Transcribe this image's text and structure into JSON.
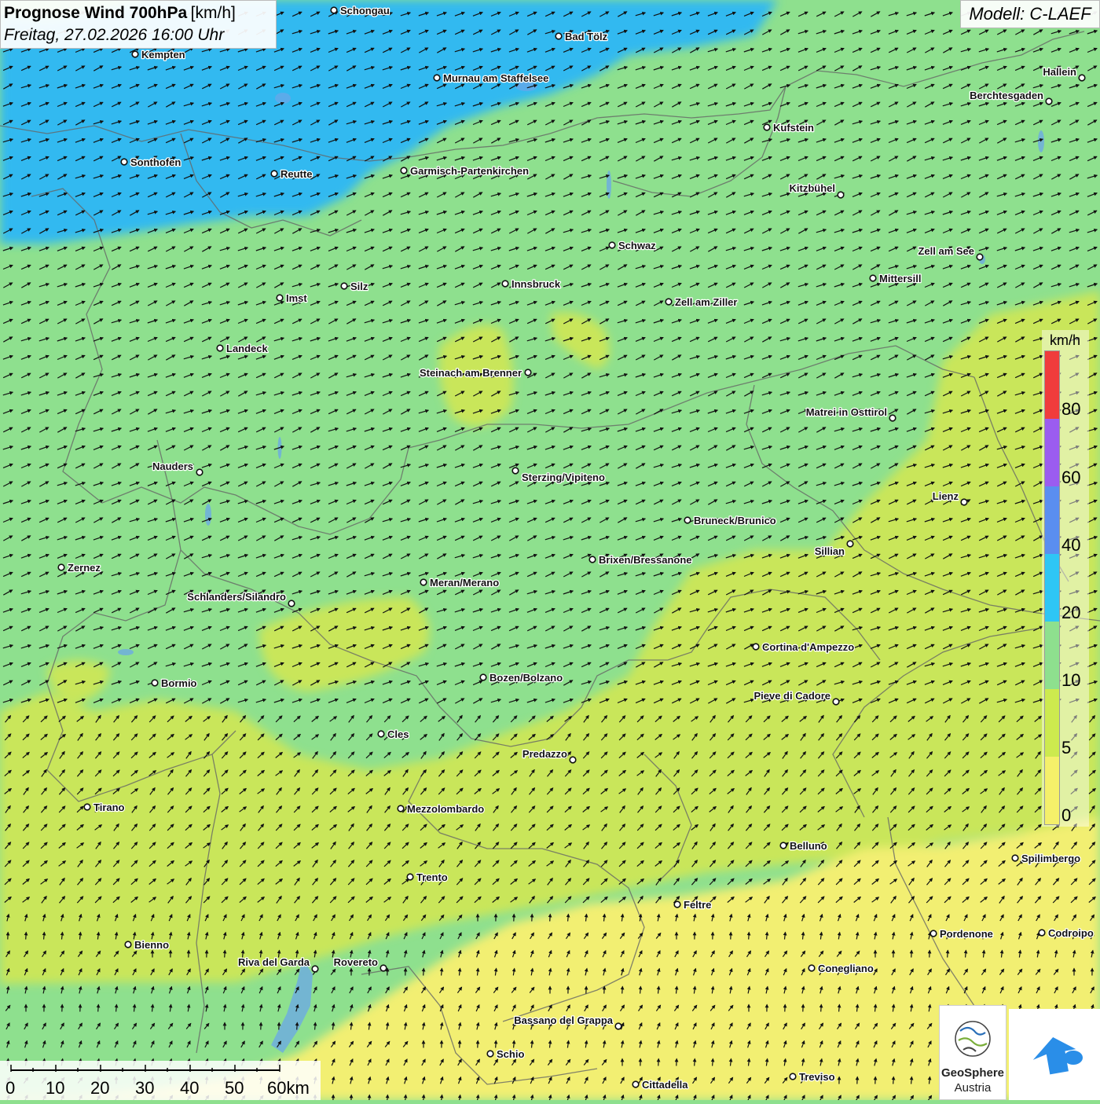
{
  "title": {
    "main": "Prognose Wind 700hPa",
    "unit": "[km/h]",
    "date": "Freitag, 27.02.2026 16:00 Uhr"
  },
  "model": "Modell: C-LAEF",
  "legend": {
    "unit": "km/h",
    "labels": [
      "80",
      "60",
      "40",
      "20",
      "10",
      "5",
      "0"
    ],
    "colors": [
      "#f03c3c",
      "#9b5cf0",
      "#5a8ef0",
      "#2ec6f5",
      "#8ee08e",
      "#cdea4e",
      "#f5f06a"
    ]
  },
  "scale": {
    "labels": [
      "0",
      "10",
      "20",
      "30",
      "40",
      "50",
      "60km"
    ]
  },
  "logo": {
    "name_line1": "GeoSphere",
    "name_line2": "Austria",
    "icon": "geosphere-logo-icon",
    "app_icon": "app-arrow-icon"
  },
  "wind_colors": {
    "fast": "#33b9f0",
    "medium": "#8ee08e",
    "light": "#c9e65a",
    "calm": "#f2ef72"
  },
  "cities": [
    {
      "name": "Schongau",
      "dot": [
        425,
        13
      ],
      "lab": [
        433,
        18
      ],
      "a": "start"
    },
    {
      "name": "Bad Tölz",
      "dot": [
        711,
        46
      ],
      "lab": [
        719,
        51
      ],
      "a": "start"
    },
    {
      "name": "Kempten",
      "dot": [
        172,
        69
      ],
      "lab": [
        180,
        74
      ],
      "a": "start"
    },
    {
      "name": "Murnau am Staffelsee",
      "dot": [
        556,
        99
      ],
      "lab": [
        564,
        104
      ],
      "a": "start"
    },
    {
      "name": "Hallein",
      "dot": [
        1377,
        99
      ],
      "lab": [
        1370,
        96
      ],
      "a": "end"
    },
    {
      "name": "Berchtesgaden",
      "dot": [
        1335,
        129
      ],
      "lab": [
        1328,
        126
      ],
      "a": "end"
    },
    {
      "name": "Kufstein",
      "dot": [
        976,
        162
      ],
      "lab": [
        984,
        167
      ],
      "a": "start"
    },
    {
      "name": "Sonthofen",
      "dot": [
        158,
        206
      ],
      "lab": [
        166,
        211
      ],
      "a": "start"
    },
    {
      "name": "Reutte",
      "dot": [
        349,
        221
      ],
      "lab": [
        357,
        226
      ],
      "a": "start"
    },
    {
      "name": "Garmisch-Partenkirchen",
      "dot": [
        514,
        217
      ],
      "lab": [
        522,
        222
      ],
      "a": "start"
    },
    {
      "name": "Kitzbühel",
      "dot": [
        1070,
        248
      ],
      "lab": [
        1063,
        244
      ],
      "a": "end"
    },
    {
      "name": "Schwaz",
      "dot": [
        779,
        312
      ],
      "lab": [
        787,
        317
      ],
      "a": "start"
    },
    {
      "name": "Zell am See",
      "dot": [
        1247,
        327
      ],
      "lab": [
        1240,
        324
      ],
      "a": "end"
    },
    {
      "name": "Mittersill",
      "dot": [
        1111,
        354
      ],
      "lab": [
        1119,
        359
      ],
      "a": "start"
    },
    {
      "name": "Silz",
      "dot": [
        438,
        364
      ],
      "lab": [
        446,
        369
      ],
      "a": "start"
    },
    {
      "name": "Innsbruck",
      "dot": [
        643,
        361
      ],
      "lab": [
        651,
        366
      ],
      "a": "start"
    },
    {
      "name": "Imst",
      "dot": [
        356,
        379
      ],
      "lab": [
        364,
        384
      ],
      "a": "start"
    },
    {
      "name": "Zell am Ziller",
      "dot": [
        851,
        384
      ],
      "lab": [
        859,
        389
      ],
      "a": "start"
    },
    {
      "name": "Landeck",
      "dot": [
        280,
        443
      ],
      "lab": [
        288,
        448
      ],
      "a": "start"
    },
    {
      "name": "Steinach am Brenner",
      "dot": [
        672,
        474
      ],
      "lab": [
        664,
        479
      ],
      "a": "end"
    },
    {
      "name": "Matrei in Osttirol",
      "dot": [
        1136,
        532
      ],
      "lab": [
        1129,
        529
      ],
      "a": "end"
    },
    {
      "name": "Nauders",
      "dot": [
        254,
        601
      ],
      "lab": [
        246,
        598
      ],
      "a": "end"
    },
    {
      "name": "Sterzing/Vipiteno",
      "dot": [
        656,
        599
      ],
      "lab": [
        664,
        612
      ],
      "a": "start"
    },
    {
      "name": "Lienz",
      "dot": [
        1227,
        639
      ],
      "lab": [
        1220,
        636
      ],
      "a": "end"
    },
    {
      "name": "Bruneck/Brunico",
      "dot": [
        875,
        662
      ],
      "lab": [
        883,
        667
      ],
      "a": "start"
    },
    {
      "name": "Sillian",
      "dot": [
        1082,
        692
      ],
      "lab": [
        1075,
        706
      ],
      "a": "end"
    },
    {
      "name": "Brixen/Bressanone",
      "dot": [
        754,
        712
      ],
      "lab": [
        762,
        717
      ],
      "a": "start"
    },
    {
      "name": "Zernez",
      "dot": [
        78,
        722
      ],
      "lab": [
        86,
        727
      ],
      "a": "start"
    },
    {
      "name": "Meran/Merano",
      "dot": [
        539,
        741
      ],
      "lab": [
        547,
        746
      ],
      "a": "start"
    },
    {
      "name": "Schlanders/Silandro",
      "dot": [
        371,
        768
      ],
      "lab": [
        364,
        764
      ],
      "a": "end"
    },
    {
      "name": "Cortina d'Ampezzo",
      "dot": [
        962,
        823
      ],
      "lab": [
        970,
        828
      ],
      "a": "start"
    },
    {
      "name": "Bozen/Bolzano",
      "dot": [
        615,
        862
      ],
      "lab": [
        623,
        867
      ],
      "a": "start"
    },
    {
      "name": "Bormio",
      "dot": [
        197,
        869
      ],
      "lab": [
        205,
        874
      ],
      "a": "start"
    },
    {
      "name": "Pieve di Cadore",
      "dot": [
        1064,
        893
      ],
      "lab": [
        1057,
        890
      ],
      "a": "end"
    },
    {
      "name": "Cles",
      "dot": [
        485,
        934
      ],
      "lab": [
        493,
        939
      ],
      "a": "start"
    },
    {
      "name": "Predazzo",
      "dot": [
        729,
        967
      ],
      "lab": [
        722,
        964
      ],
      "a": "end"
    },
    {
      "name": "Tirano",
      "dot": [
        111,
        1027
      ],
      "lab": [
        119,
        1032
      ],
      "a": "start"
    },
    {
      "name": "Mezzolombardo",
      "dot": [
        510,
        1029
      ],
      "lab": [
        518,
        1034
      ],
      "a": "start"
    },
    {
      "name": "Belluno",
      "dot": [
        997,
        1076
      ],
      "lab": [
        1005,
        1081
      ],
      "a": "start"
    },
    {
      "name": "Spilimbergo",
      "dot": [
        1292,
        1092
      ],
      "lab": [
        1300,
        1097
      ],
      "a": "start"
    },
    {
      "name": "Trento",
      "dot": [
        522,
        1116
      ],
      "lab": [
        530,
        1121
      ],
      "a": "start"
    },
    {
      "name": "Feltre",
      "dot": [
        862,
        1151
      ],
      "lab": [
        870,
        1156
      ],
      "a": "start"
    },
    {
      "name": "Pordenone",
      "dot": [
        1188,
        1188
      ],
      "lab": [
        1196,
        1193
      ],
      "a": "start"
    },
    {
      "name": "Codroipo",
      "dot": [
        1326,
        1187
      ],
      "lab": [
        1334,
        1192
      ],
      "a": "start"
    },
    {
      "name": "Bienno",
      "dot": [
        163,
        1202
      ],
      "lab": [
        171,
        1207
      ],
      "a": "start"
    },
    {
      "name": "Riva del Garda",
      "dot": [
        401,
        1233
      ],
      "lab": [
        394,
        1229
      ],
      "a": "end"
    },
    {
      "name": "Rovereto",
      "dot": [
        488,
        1232
      ],
      "lab": [
        481,
        1229
      ],
      "a": "end"
    },
    {
      "name": "Conegliano",
      "dot": [
        1033,
        1232
      ],
      "lab": [
        1041,
        1237
      ],
      "a": "start"
    },
    {
      "name": "Bassano del Grappa",
      "dot": [
        787,
        1306
      ],
      "lab": [
        780,
        1303
      ],
      "a": "end"
    },
    {
      "name": "Schio",
      "dot": [
        624,
        1341
      ],
      "lab": [
        632,
        1346
      ],
      "a": "start"
    },
    {
      "name": "Treviso",
      "dot": [
        1009,
        1370
      ],
      "lab": [
        1017,
        1375
      ],
      "a": "start"
    },
    {
      "name": "Cittadella",
      "dot": [
        809,
        1380
      ],
      "lab": [
        817,
        1385
      ],
      "a": "start"
    }
  ]
}
